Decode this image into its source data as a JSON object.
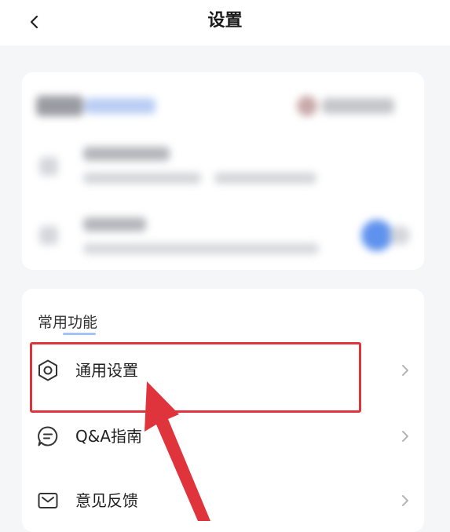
{
  "header": {
    "title": "设置",
    "back_icon": "chevron-left-icon"
  },
  "functions": {
    "section_title": "常用功能",
    "items": [
      {
        "label": "通用设置",
        "icon": "gear-icon",
        "highlighted": true
      },
      {
        "label": "Q&A指南",
        "icon": "chat-bubble-icon"
      },
      {
        "label": "意见反馈",
        "icon": "mail-icon"
      }
    ]
  },
  "colors": {
    "annotation_red": "#e0343d",
    "accent_blue": "#4a8af4",
    "icon_dark": "#333333",
    "chevron_gray": "#b5b5b5"
  }
}
